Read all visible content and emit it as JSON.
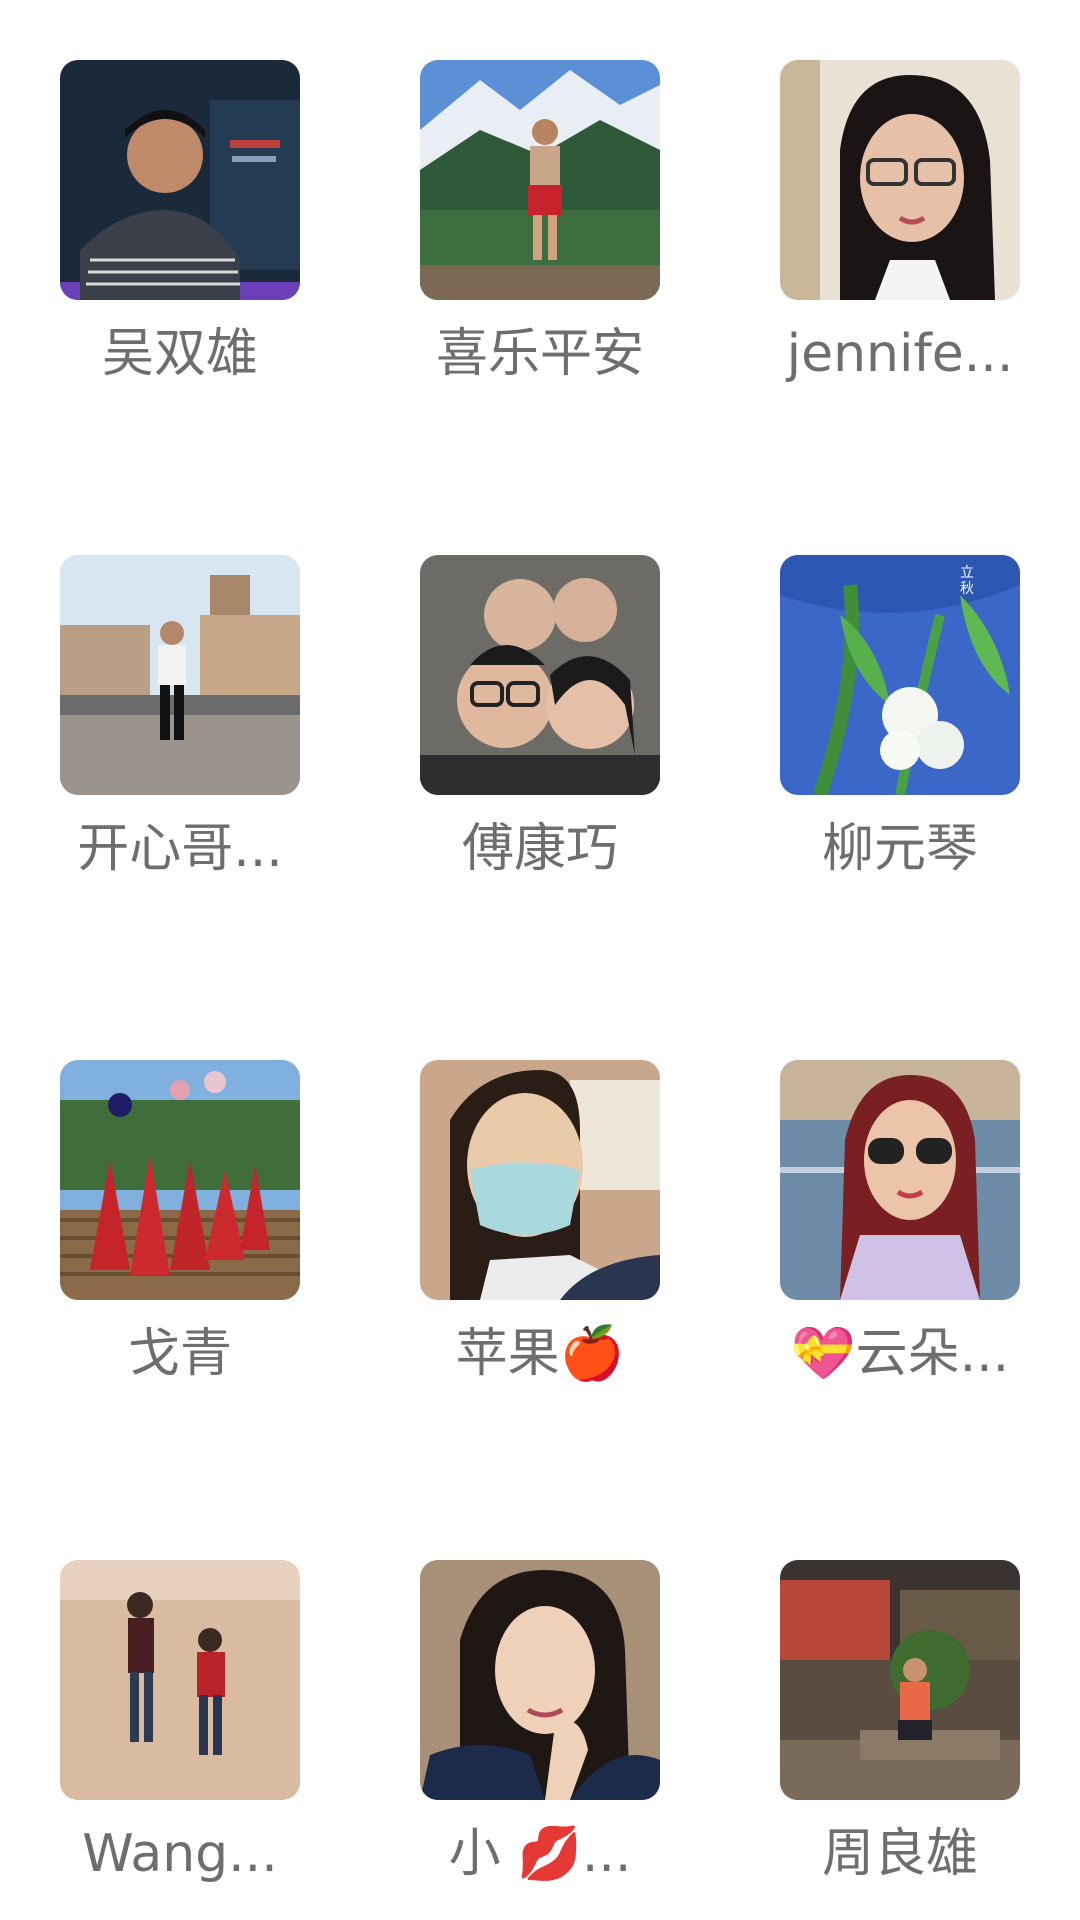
{
  "members": [
    {
      "name": "吴双雄",
      "avatar": "photo-man-dark-poster"
    },
    {
      "name": "喜乐平安",
      "avatar": "photo-woman-mountains"
    },
    {
      "name": "jennife...",
      "avatar": "photo-woman-glasses"
    },
    {
      "name": "开心哥...",
      "avatar": "photo-man-street"
    },
    {
      "name": "傅康巧",
      "avatar": "photo-group-selfie"
    },
    {
      "name": "柳元琴",
      "avatar": "photo-white-flower-blue-sky"
    },
    {
      "name": "戈青",
      "avatar": "photo-women-red-dresses"
    },
    {
      "name": "苹果🍎",
      "avatar": "photo-woman-mask"
    },
    {
      "name": "💝云朵...",
      "avatar": "photo-woman-sunglasses-canal"
    },
    {
      "name": "Wang...",
      "avatar": "photo-two-people-beach"
    },
    {
      "name": "小 💋...",
      "avatar": "photo-woman-hand-chin"
    },
    {
      "name": "周良雄",
      "avatar": "photo-man-sitting-night"
    }
  ],
  "colors": {
    "background": "#ffffff",
    "name_text": "#6e6e6e"
  }
}
